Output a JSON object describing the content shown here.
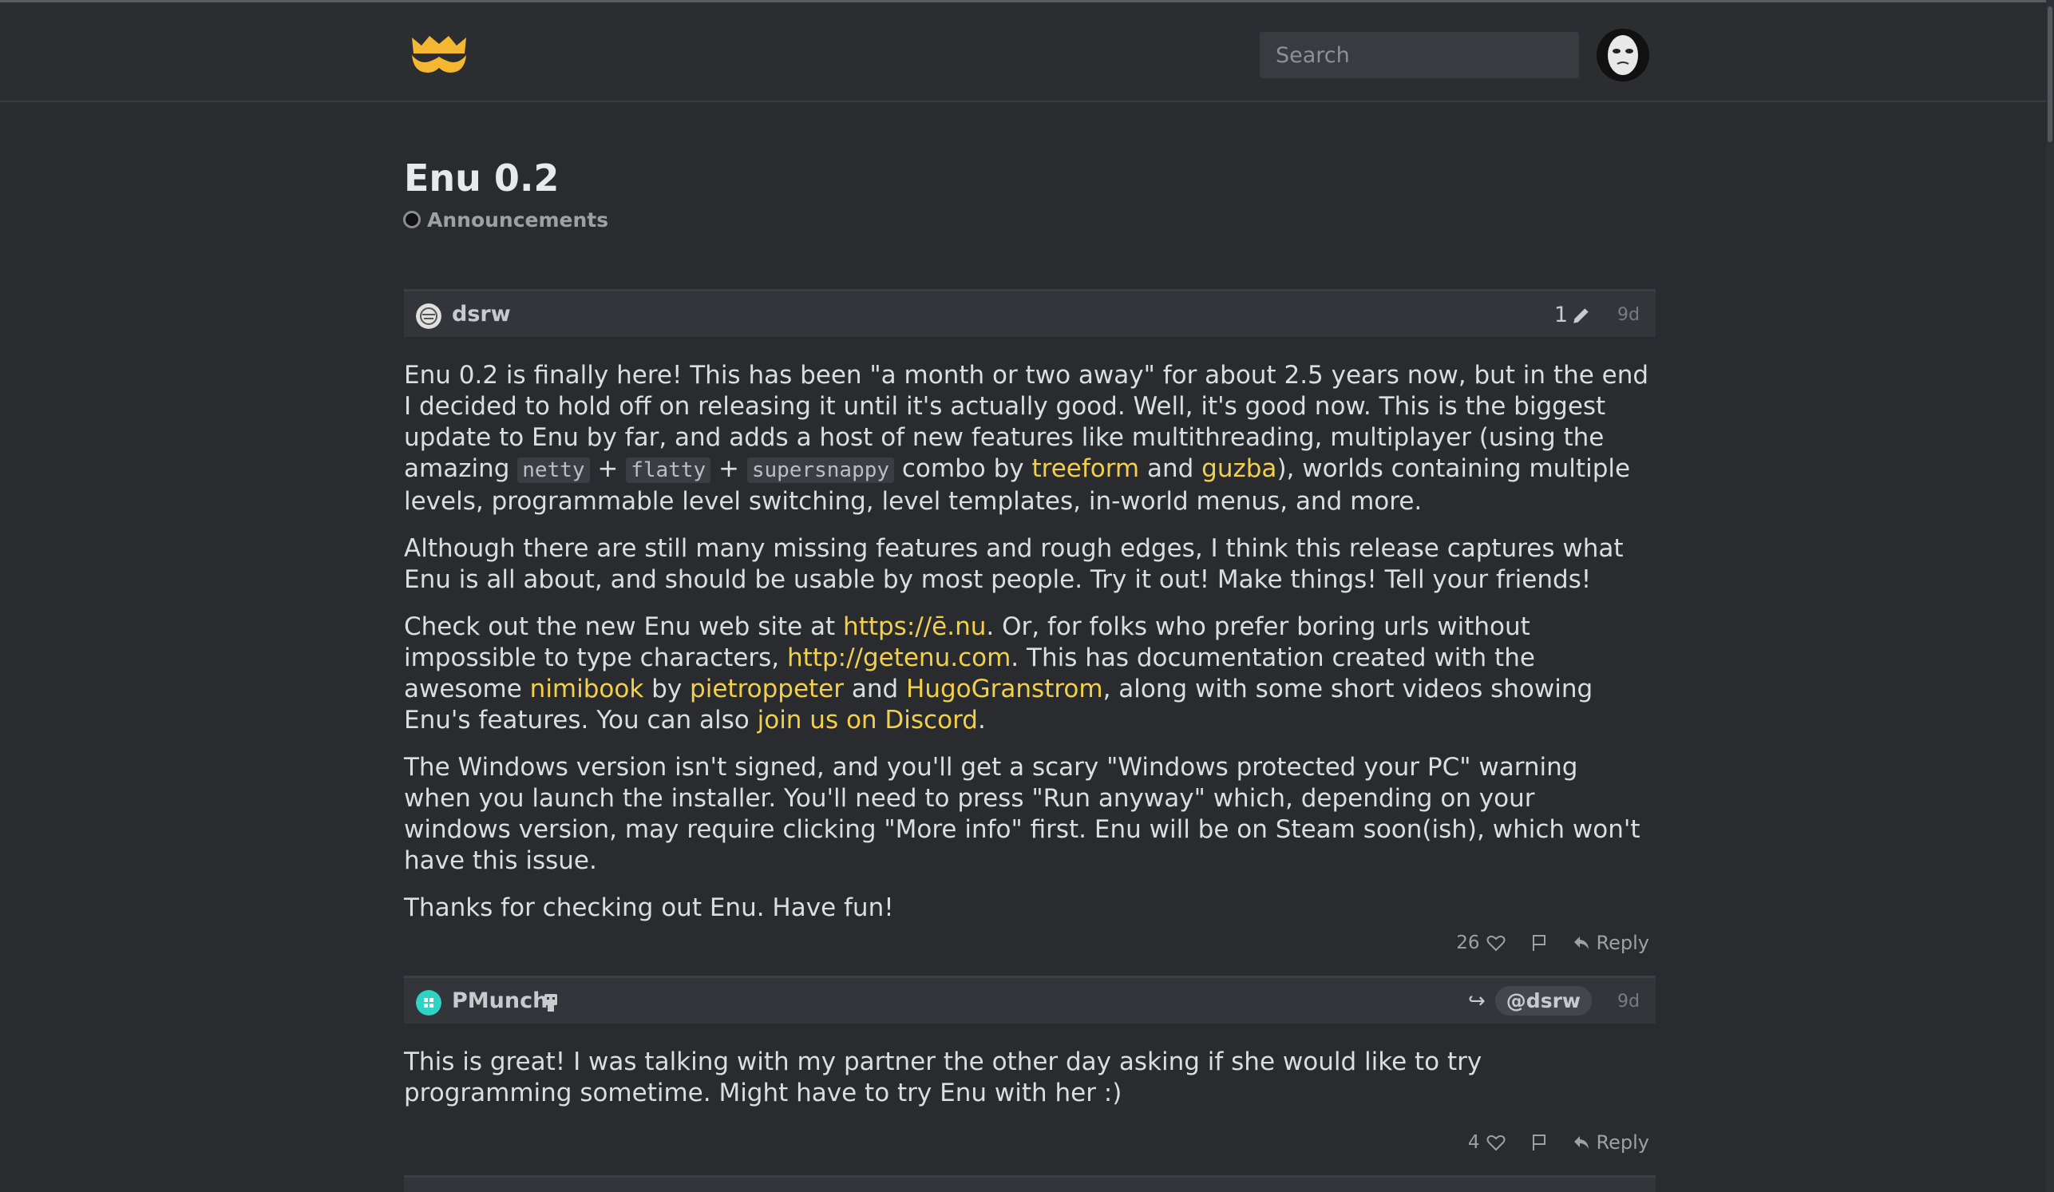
{
  "header": {
    "search_placeholder": "Search"
  },
  "topic": {
    "title": "Enu 0.2",
    "category": "Announcements"
  },
  "posts": [
    {
      "username": "dsrw",
      "edit_count": "1",
      "age": "9d",
      "paragraphs": {
        "p1_a": "Enu 0.2 is finally here! This has been \"a month or two away\" for about 2.5 years now, but in the end I decided to hold off on releasing it until it's actually good. Well, it's good now. This is the biggest update to Enu by far, and adds a host of new features like multithreading, multiplayer (using the amazing ",
        "code_netty": "netty",
        "plus1": " + ",
        "code_flatty": "flatty",
        "plus2": " + ",
        "code_supersnappy": "supersnappy",
        "combo_by": " combo by ",
        "link_treeform": "treeform",
        "and1": " and ",
        "link_guzba": "guzba",
        "p1_b": "), worlds containing multiple levels, programmable level switching, level templates, in-world menus, and more.",
        "p2": "Although there are still many missing features and rough edges, I think this release captures what Enu is all about, and should be usable by most people. Try it out! Make things! Tell your friends!",
        "p3_a": "Check out the new Enu web site at ",
        "link_enu": "https://ē.nu",
        "p3_b": ". Or, for folks who prefer boring urls without impossible to type characters, ",
        "link_getenu": "http://getenu.com",
        "p3_c": ". This has documentation created with the awesome ",
        "link_nimibook": "nimibook",
        "by": " by ",
        "link_pietroppeter": "pietroppeter",
        "and2": " and ",
        "link_hugo": "HugoGranstrom",
        "p3_d": ", along with some short videos showing Enu's features. You can also ",
        "link_discord": "join us on Discord",
        "p3_e": ".",
        "p4": "The Windows version isn't signed, and you'll get a scary \"Windows protected your PC\" warning when you launch the installer. You'll need to press \"Run anyway\" which, depending on your windows version, may require clicking \"More info\" first. Enu will be on Steam soon(ish), which won't have this issue.",
        "p5": "Thanks for checking out Enu. Have fun!"
      },
      "likes": "26",
      "reply_label": "Reply"
    },
    {
      "username": "PMunch",
      "reply_to": "@dsrw",
      "age": "9d",
      "text": "This is great! I was talking with my partner the other day asking if she would like to try programming sometime. Might have to try Enu with her :)",
      "likes": "4",
      "reply_label": "Reply"
    }
  ],
  "colors": {
    "background": "#292b2f",
    "link": "#f3d04a",
    "logo": "#f5b731",
    "pmunch_avatar": "#2fd3c3"
  },
  "icons": [
    "logo-crown-mustache",
    "heart-icon",
    "flag-icon",
    "reply-icon",
    "pencil-icon",
    "reply-arrow-icon",
    "robot-flair-icon"
  ]
}
